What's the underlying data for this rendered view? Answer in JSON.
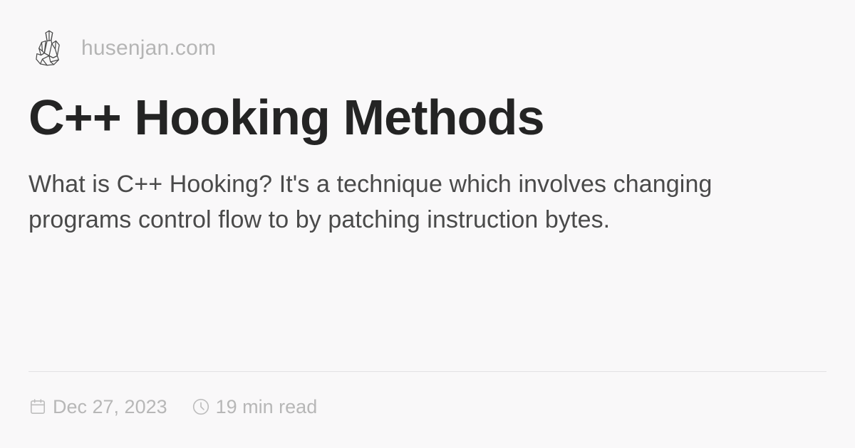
{
  "site": {
    "name": "husenjan.com",
    "logo_icon": "crystal-logo-icon"
  },
  "article": {
    "title": "C++ Hooking Methods",
    "description": "What is C++ Hooking? It's a technique which involves changing programs control flow to by patching instruction bytes."
  },
  "meta": {
    "date": "Dec 27, 2023",
    "date_icon": "calendar-icon",
    "read_time": "19 min read",
    "read_time_icon": "clock-icon"
  },
  "colors": {
    "background": "#f9f8f9",
    "title": "#242424",
    "description": "#4a4a4a",
    "muted": "#b7b7b7",
    "divider": "#e3e2e4"
  }
}
